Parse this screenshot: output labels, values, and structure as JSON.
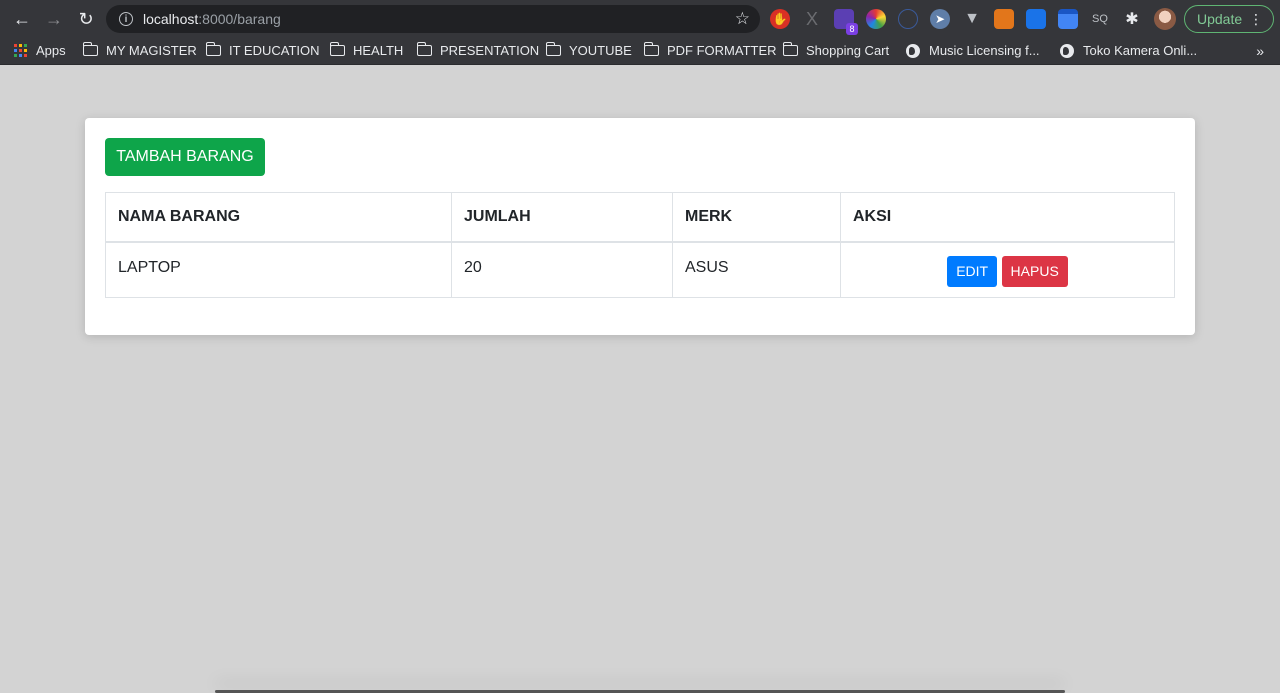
{
  "browser": {
    "url_host": "localhost",
    "url_path": ":8000/barang",
    "update_label": "Update",
    "extension_badge": "8",
    "bookmarks": [
      {
        "label": "Apps",
        "icon": "apps-grid-icon"
      },
      {
        "label": "MY MAGISTER",
        "icon": "folder-icon"
      },
      {
        "label": "IT EDUCATION",
        "icon": "folder-icon"
      },
      {
        "label": "HEALTH",
        "icon": "folder-icon"
      },
      {
        "label": "PRESENTATION",
        "icon": "folder-icon"
      },
      {
        "label": "YOUTUBE",
        "icon": "folder-icon"
      },
      {
        "label": "PDF FORMATTER",
        "icon": "folder-icon"
      },
      {
        "label": "Shopping Cart",
        "icon": "folder-icon"
      },
      {
        "label": "Music Licensing f...",
        "icon": "globe-icon"
      },
      {
        "label": "Toko Kamera Onli...",
        "icon": "globe-icon"
      }
    ],
    "overflow_label": "»"
  },
  "page": {
    "add_button_label": "TAMBAH BARANG",
    "table": {
      "headers": [
        "NAMA BARANG",
        "JUMLAH",
        "MERK",
        "AKSI"
      ],
      "rows": [
        {
          "nama": "LAPTOP",
          "jumlah": "20",
          "merk": "ASUS",
          "edit_label": "EDIT",
          "hapus_label": "HAPUS"
        }
      ]
    }
  },
  "colors": {
    "add_button": "#0ea54a",
    "edit_button": "#007bff",
    "hapus_button": "#dc3545",
    "page_background": "#d3d3d3"
  }
}
